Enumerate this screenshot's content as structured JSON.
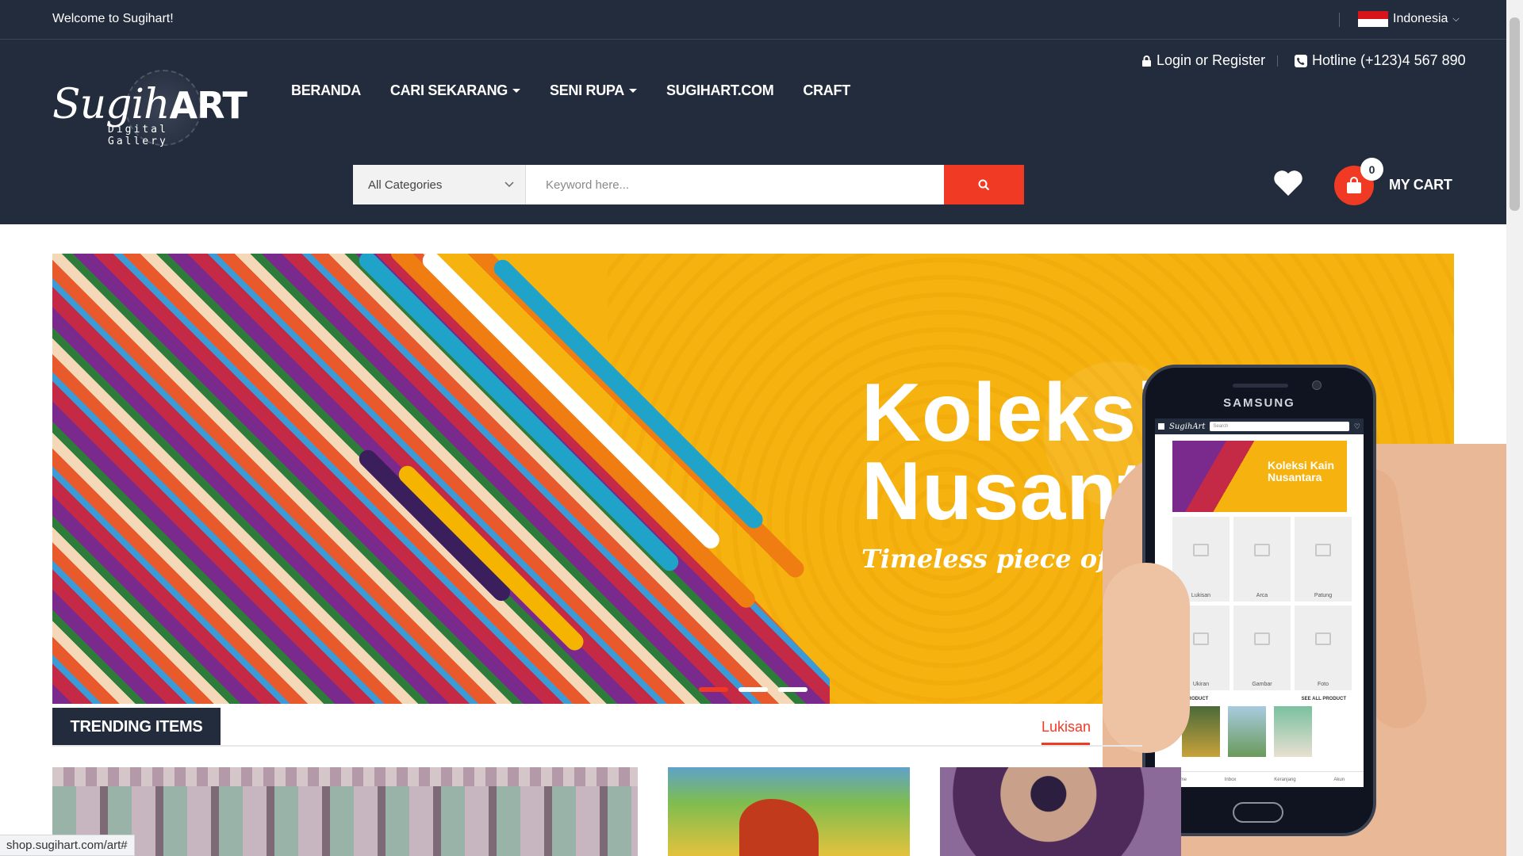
{
  "topbar": {
    "welcome": "Welcome to Sugihart!",
    "language": "Indonesia"
  },
  "brand": {
    "logo_main": "Sugih",
    "logo_bold": "ART",
    "logo_sub": "Digital Gallery"
  },
  "nav": {
    "items": [
      {
        "label": "BERANDA",
        "dropdown": false
      },
      {
        "label": "CARI SEKARANG",
        "dropdown": true
      },
      {
        "label": "SENI RUPA",
        "dropdown": true
      },
      {
        "label": "SUGIHART.COM",
        "dropdown": false
      },
      {
        "label": "CRAFT",
        "dropdown": false
      }
    ]
  },
  "account": {
    "login": "Login or Register",
    "hotline": "Hotline (+123)4 567 890"
  },
  "search": {
    "category": "All Categories",
    "placeholder": "Keyword here..."
  },
  "cart": {
    "count": "0",
    "label": "MY CART"
  },
  "banner": {
    "title_line1": "Koleksi Kain",
    "title_line2": "Nusantara",
    "tagline": "Timeless piece of heritage",
    "slides": 3,
    "active_slide": 0
  },
  "phone": {
    "brand": "SAMSUNG",
    "app_logo": "SugihArt",
    "search_placeholder": "Search",
    "banner_text": "Koleksi Kain Nusantara",
    "categories": [
      "Lukisan",
      "Arca",
      "Patung",
      "Ukiran",
      "Gambar",
      "Foto"
    ],
    "new_product": "NEW PRODUCT",
    "see_all": "SEE ALL PRODUCT",
    "footer": [
      "Home",
      "Inbox",
      "Keranjang",
      "Akun"
    ]
  },
  "trending": {
    "title": "TRENDING ITEMS",
    "active_category": "Lukisan"
  },
  "status_url": "shop.sugihart.com/art#",
  "colors": {
    "header_bg": "#232c3d",
    "accent": "#f03a24",
    "banner_bg": "#f6b310"
  }
}
